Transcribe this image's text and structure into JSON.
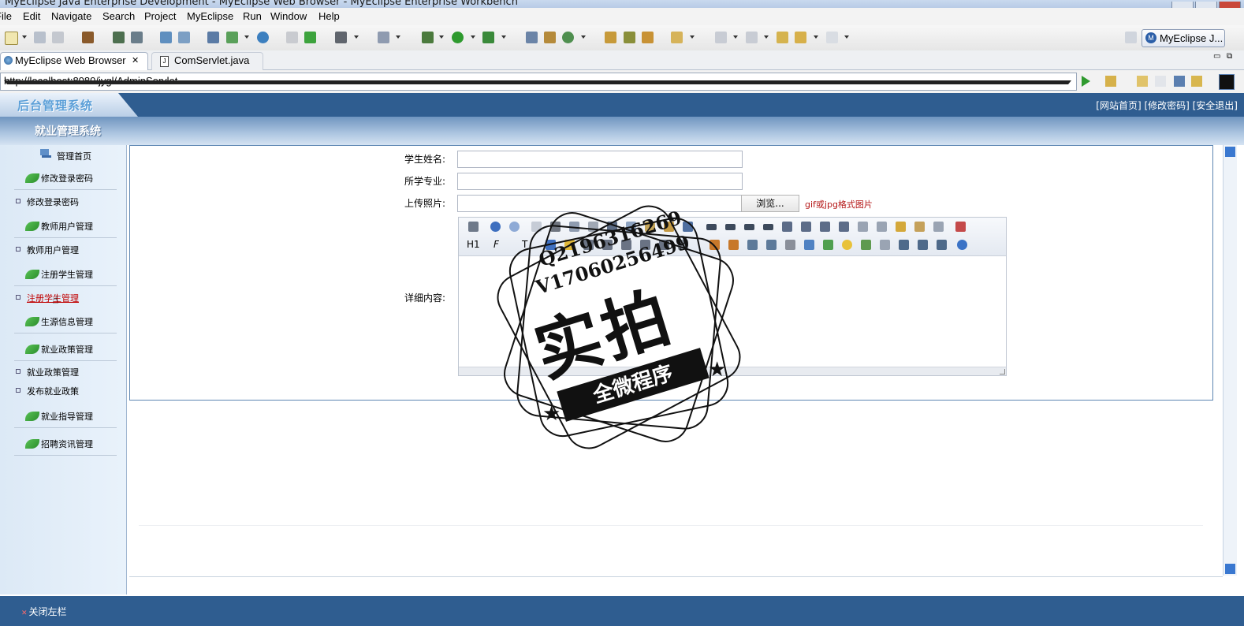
{
  "window": {
    "title": "MyEclipse Java Enterprise Development - MyEclipse Web Browser - MyEclipse Enterprise Workbench"
  },
  "menubar": [
    "File",
    "Edit",
    "Navigate",
    "Search",
    "Project",
    "MyEclipse",
    "Run",
    "Window",
    "Help"
  ],
  "perspective": {
    "label": "MyEclipse J..."
  },
  "tabs": [
    {
      "label": "MyEclipse Web Browser",
      "active": true,
      "closable": true
    },
    {
      "label": "ComServlet.java",
      "active": false
    }
  ],
  "browser": {
    "url": "http://localhost:8080/jygl/AdminServlet"
  },
  "header": {
    "logo": "后台管理系统",
    "links": "[网站首页] [修改密码] [安全退出]",
    "subtitle": "就业管理系统"
  },
  "sidebar": {
    "home": "管理首页",
    "items": [
      {
        "type": "section",
        "label": "修改登录密码"
      },
      {
        "type": "link",
        "label": "修改登录密码"
      },
      {
        "type": "section",
        "label": "教师用户管理"
      },
      {
        "type": "link",
        "label": "教师用户管理"
      },
      {
        "type": "section",
        "label": "注册学生管理"
      },
      {
        "type": "link",
        "label": "注册学生管理",
        "active": true
      },
      {
        "type": "section",
        "label": "生源信息管理"
      },
      {
        "type": "section",
        "label": "就业政策管理"
      },
      {
        "type": "link",
        "label": "就业政策管理"
      },
      {
        "type": "link",
        "label": "发布就业政策"
      },
      {
        "type": "section",
        "label": "就业指导管理"
      },
      {
        "type": "section",
        "label": "招聘资讯管理"
      }
    ]
  },
  "form": {
    "name_label": "学生姓名:",
    "name_value": "",
    "major_label": "所学专业:",
    "major_value": "",
    "photo_label": "上传照片:",
    "photo_value": "",
    "browse_label": "浏览...",
    "photo_hint": "gif或jpg格式图片",
    "detail_label": "详细内容:",
    "editor_toolbar_row2": [
      "H1",
      "F",
      "T"
    ]
  },
  "footer": {
    "close_sidebar": "关闭左栏"
  },
  "watermark": {
    "qq": "Q2196316269",
    "v": "V17060256499",
    "main": "实拍",
    "banner": "全微程序"
  },
  "colors": {
    "header_blue": "#2f5d90",
    "sidebar_bg": "#e3eef9",
    "active_link": "#c00000",
    "hint_red": "#b51818"
  }
}
